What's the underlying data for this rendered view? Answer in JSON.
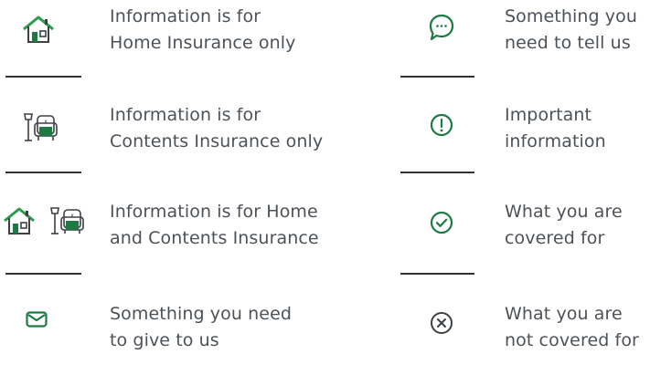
{
  "colors": {
    "green": "#1e7a43",
    "green_light": "#4faa63",
    "gray": "#3c4146",
    "text": "#4d5258"
  },
  "left": [
    {
      "icon": "house-icon",
      "lines": [
        "Information is for",
        "Home Insurance only"
      ]
    },
    {
      "icon": "lamp-armchair-icon",
      "lines": [
        "Information is for",
        "Contents Insurance only"
      ]
    },
    {
      "icon": "house-lamp-armchair-icon",
      "lines": [
        "Information is for Home",
        "and Contents Insurance"
      ]
    },
    {
      "icon": "envelope-icon",
      "lines": [
        "Something you need",
        "to give to us"
      ]
    }
  ],
  "right": [
    {
      "icon": "speech-bubble-icon",
      "lines": [
        "Something you",
        "need to tell us"
      ]
    },
    {
      "icon": "exclamation-circle-icon",
      "lines": [
        "Important",
        "information"
      ]
    },
    {
      "icon": "check-circle-icon",
      "lines": [
        "What you are",
        "covered for"
      ]
    },
    {
      "icon": "x-circle-icon",
      "lines": [
        "What you are",
        "not covered for"
      ]
    }
  ]
}
